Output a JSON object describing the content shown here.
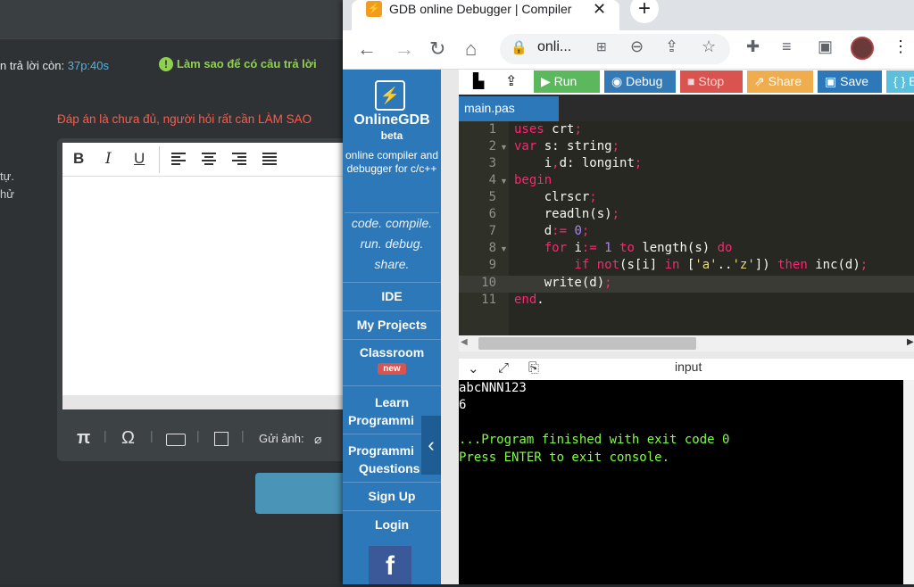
{
  "background_page": {
    "timer_label": "n trả lời còn:",
    "timer_value": "37p:40s",
    "howto_text": "Làm sao để có câu trả lời",
    "warning_text": "Đáp án là chưa đủ, người hỏi rất cần LÀM SAO",
    "side_text_1": "tự.",
    "side_text_2": "hử",
    "toolbar": {
      "bold": "B",
      "italic": "I",
      "underline": "U"
    },
    "tools": {
      "pi": "π",
      "omega": "Ω",
      "upload_label": "Gửi ảnh:"
    }
  },
  "browser": {
    "tab_title": "GDB online Debugger | Compiler",
    "favicon": "⚡",
    "url": "onli...",
    "newtab": "+"
  },
  "sidebar": {
    "brand": "OnlineGDB",
    "beta": "beta",
    "tagline": "online compiler and debugger for c/c++",
    "motto_1": "code. compile.",
    "motto_2": "run. debug.",
    "motto_3": "share.",
    "items": {
      "ide": "IDE",
      "projects": "My Projects",
      "classroom": "Classroom",
      "new_badge": "new",
      "learn_1": "Learn",
      "learn_2": "Programmi",
      "questions_1": "Programmi",
      "questions_2": "Questions",
      "signup": "Sign Up",
      "login": "Login"
    }
  },
  "toolbar": {
    "run": "Run",
    "debug": "Debug",
    "stop": "Stop",
    "share": "Share",
    "save": "Save",
    "beautify": "{ } B",
    "colors": {
      "run": "#5cb85c",
      "debug": "#337ab7",
      "stop": "#d9534f",
      "share": "#f0ad4e",
      "save": "#2d78b8",
      "beautify": "#5bc0de"
    }
  },
  "editor": {
    "file_tab": "main.pas",
    "line_numbers": [
      "1",
      "2",
      "3",
      "4",
      "5",
      "6",
      "7",
      "8",
      "9",
      "10",
      "11"
    ],
    "lines": {
      "l1a": "uses",
      "l1b": " crt",
      "l1c": ";",
      "l2a": "var",
      "l2b": " s: string",
      "l2c": ";",
      "l3a": "    i",
      "l3b": ",",
      "l3c": "d: longint",
      "l3d": ";",
      "l4a": "begin",
      "l5a": "    clrscr",
      "l5b": ";",
      "l6a": "    readln(s)",
      "l6b": ";",
      "l7a": "    d",
      "l7b": ":=",
      "l7c": " 0",
      "l7d": ";",
      "l8a": "    for",
      "l8b": " i",
      "l8c": ":=",
      "l8d": " 1",
      "l8e": " to",
      "l8f": " length(s) ",
      "l8g": "do",
      "l9a": "        if",
      "l9b": " not",
      "l9c": "(s[i] ",
      "l9d": "in",
      "l9e": " [",
      "l9f": "'a'",
      "l9g": "..",
      "l9h": "'z'",
      "l9i": "]) ",
      "l9j": "then",
      "l9k": " inc(d)",
      "l9l": ";",
      "l10a": "    write(d)",
      "l10b": ";",
      "l11a": "end",
      "l11b": "."
    }
  },
  "io": {
    "label": "input",
    "console_lines": [
      "abcNNN123",
      "6",
      "",
      "...Program finished with exit code 0",
      "Press ENTER to exit console."
    ],
    "colors": {
      "output": "#ffffff",
      "status": "#7fff3f"
    }
  }
}
